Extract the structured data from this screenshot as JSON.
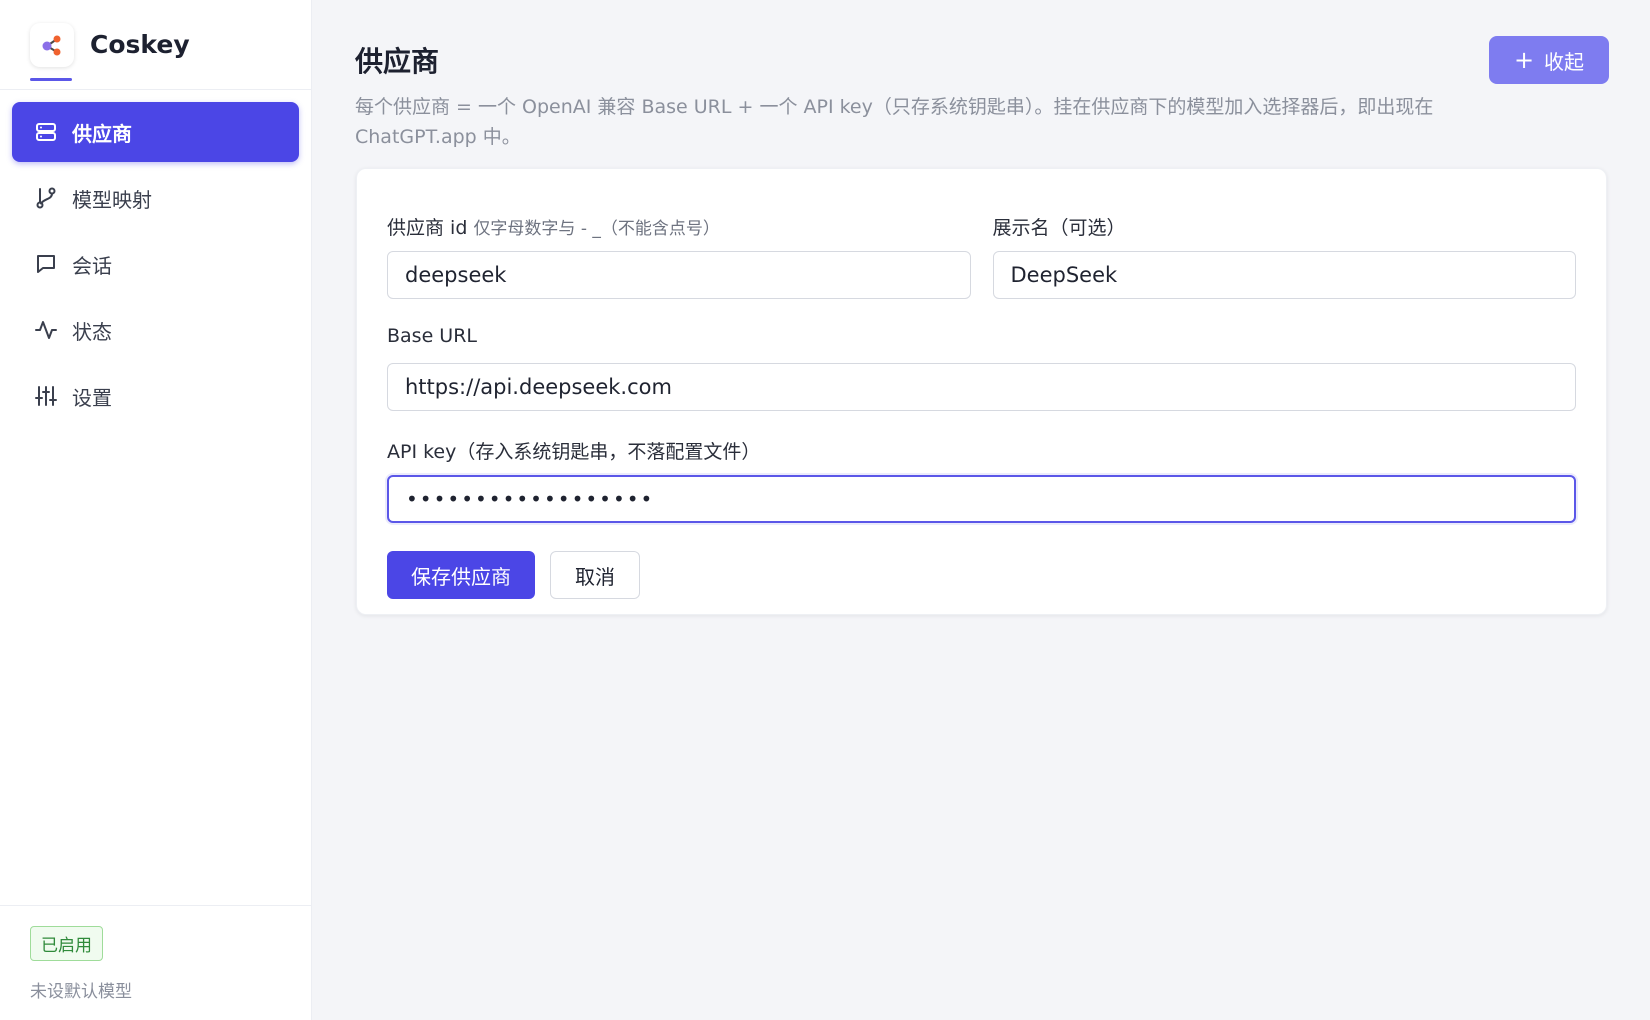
{
  "app": {
    "name": "Coskey"
  },
  "sidebar": {
    "items": [
      {
        "label": "供应商",
        "icon": "server-icon",
        "active": true
      },
      {
        "label": "模型映射",
        "icon": "branch-icon",
        "active": false
      },
      {
        "label": "会话",
        "icon": "chat-icon",
        "active": false
      },
      {
        "label": "状态",
        "icon": "activity-icon",
        "active": false
      },
      {
        "label": "设置",
        "icon": "sliders-icon",
        "active": false
      }
    ],
    "footer": {
      "badge": "已启用",
      "note": "未设默认模型"
    }
  },
  "main": {
    "title": "供应商",
    "description": "每个供应商 = 一个 OpenAI 兼容 Base URL + 一个 API key（只存系统钥匙串）。挂在供应商下的模型加入选择器后，即出现在 ChatGPT.app 中。",
    "collapse_button": "收起"
  },
  "form": {
    "provider_id": {
      "label": "供应商 id",
      "hint": "仅字母数字与 - _（不能含点号）",
      "value": "deepseek"
    },
    "display_name": {
      "label": "展示名（可选）",
      "value": "DeepSeek"
    },
    "base_url": {
      "label": "Base URL",
      "value": "https://api.deepseek.com"
    },
    "api_key": {
      "label": "API key（存入系统钥匙串，不落配置文件）",
      "value": "••••••••••••••••••"
    },
    "save_button": "保存供应商",
    "cancel_button": "取消"
  },
  "colors": {
    "accent": "#4b46e6",
    "accent_light": "#7e7cf0",
    "success": "#2f8a3a"
  }
}
